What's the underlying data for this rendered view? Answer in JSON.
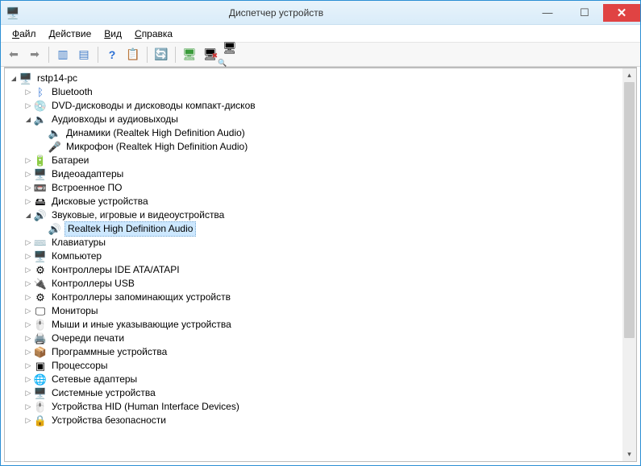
{
  "window": {
    "title": "Диспетчер устройств"
  },
  "menu": {
    "file": "Файл",
    "action": "Действие",
    "view": "Вид",
    "help": "Справка"
  },
  "tree": {
    "root": {
      "label": "rstp14-pc",
      "icon": "🖥️"
    },
    "items": [
      {
        "label": "Bluetooth",
        "icon": "ᛒ",
        "expandable": true,
        "expanded": false,
        "iconColor": "#2a6fd4"
      },
      {
        "label": "DVD-дисководы и дисководы компакт-дисков",
        "icon": "💿",
        "expandable": true,
        "expanded": false
      },
      {
        "label": "Аудиовходы и аудиовыходы",
        "icon": "🔈",
        "expandable": true,
        "expanded": true,
        "children": [
          {
            "label": "Динамики (Realtek High Definition Audio)",
            "icon": "🔈"
          },
          {
            "label": "Микрофон (Realtek High Definition Audio)",
            "icon": "🎤"
          }
        ]
      },
      {
        "label": "Батареи",
        "icon": "🔋",
        "expandable": true,
        "expanded": false
      },
      {
        "label": "Видеоадаптеры",
        "icon": "🖥️",
        "expandable": true,
        "expanded": false
      },
      {
        "label": "Встроенное ПО",
        "icon": "📼",
        "expandable": true,
        "expanded": false
      },
      {
        "label": "Дисковые устройства",
        "icon": "🖴",
        "expandable": true,
        "expanded": false
      },
      {
        "label": "Звуковые, игровые и видеоустройства",
        "icon": "🔊",
        "expandable": true,
        "expanded": true,
        "children": [
          {
            "label": "Realtek High Definition Audio",
            "icon": "🔊",
            "selected": true
          }
        ]
      },
      {
        "label": "Клавиатуры",
        "icon": "⌨️",
        "expandable": true,
        "expanded": false
      },
      {
        "label": "Компьютер",
        "icon": "🖥️",
        "expandable": true,
        "expanded": false
      },
      {
        "label": "Контроллеры IDE ATA/ATAPI",
        "icon": "⚙",
        "expandable": true,
        "expanded": false
      },
      {
        "label": "Контроллеры USB",
        "icon": "🔌",
        "expandable": true,
        "expanded": false
      },
      {
        "label": "Контроллеры запоминающих устройств",
        "icon": "⚙",
        "expandable": true,
        "expanded": false
      },
      {
        "label": "Мониторы",
        "icon": "🖵",
        "expandable": true,
        "expanded": false
      },
      {
        "label": "Мыши и иные указывающие устройства",
        "icon": "🖱️",
        "expandable": true,
        "expanded": false
      },
      {
        "label": "Очереди печати",
        "icon": "🖨️",
        "expandable": true,
        "expanded": false
      },
      {
        "label": "Программные устройства",
        "icon": "📦",
        "expandable": true,
        "expanded": false
      },
      {
        "label": "Процессоры",
        "icon": "▣",
        "expandable": true,
        "expanded": false
      },
      {
        "label": "Сетевые адаптеры",
        "icon": "🌐",
        "expandable": true,
        "expanded": false
      },
      {
        "label": "Системные устройства",
        "icon": "🖥️",
        "expandable": true,
        "expanded": false
      },
      {
        "label": "Устройства HID (Human Interface Devices)",
        "icon": "🖱️",
        "expandable": true,
        "expanded": false
      },
      {
        "label": "Устройства безопасности",
        "icon": "🔒",
        "expandable": true,
        "expanded": false,
        "cutoff": true
      }
    ]
  }
}
